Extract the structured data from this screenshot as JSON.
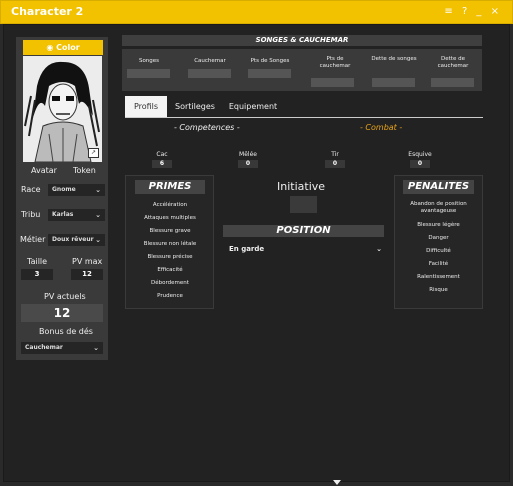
{
  "window": {
    "title": "Character 2",
    "controls": "≡ ? _ ×"
  },
  "sidebar": {
    "color_button": "Color",
    "avatar_label": "Avatar",
    "token_label": "Token",
    "race_label": "Race",
    "race_value": "Gnome",
    "tribu_label": "Tribu",
    "tribu_value": "Karlas",
    "metier_label": "Métier",
    "metier_value": "Doux rêveur",
    "taille_label": "Taille",
    "taille_value": "3",
    "pvmax_label": "PV max",
    "pvmax_value": "12",
    "pv_actuels_label": "PV actuels",
    "pv_actuels_value": "12",
    "bonus_label": "Bonus de dés",
    "bonus_value": "Cauchemar"
  },
  "songes": {
    "header": "SONGES & CAUCHEMAR",
    "cols": [
      "Songes",
      "Cauchemar",
      "Pts de Songes",
      "Pts de cauchemar",
      "Dette de songes",
      "Dette de cauchemar"
    ]
  },
  "tabs": [
    "Profils",
    "Sortileges",
    "Equipement"
  ],
  "sections": {
    "competences": "- Competences -",
    "combat": "- Combat -"
  },
  "stats": [
    {
      "label": "Cac",
      "value": "6"
    },
    {
      "label": "Mêlée",
      "value": "0"
    },
    {
      "label": "Tir",
      "value": "0"
    },
    {
      "label": "Esquive",
      "value": "0"
    }
  ],
  "primes": {
    "title": "PRIMES",
    "items": [
      "Accélération",
      "Attaques multiples",
      "Blessure grave",
      "Blessure non létale",
      "Blessure précise",
      "Efficacité",
      "Débordement",
      "Prudence"
    ]
  },
  "initiative": {
    "label": "Initiative"
  },
  "position": {
    "title": "POSITION",
    "value": "En garde"
  },
  "penalites": {
    "title": "PENALITES",
    "items": [
      "Abandon de position avantageuse",
      "Blessure légère",
      "Danger",
      "Difficulté",
      "Facilité",
      "Ralentissement",
      "Risque"
    ]
  },
  "colors": {
    "accent": "#f2c100",
    "combat": "#e8a317"
  }
}
